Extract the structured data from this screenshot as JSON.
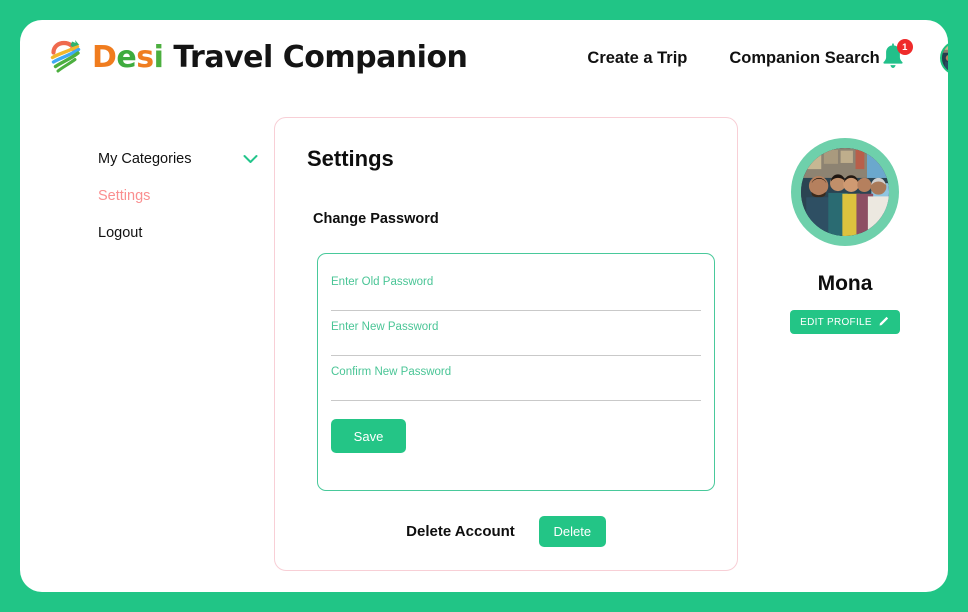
{
  "theme": {
    "page_background": "#21c586",
    "accent_green": "#23c586",
    "field_green": "#4ac596",
    "active_pink": "#fa8f90",
    "card_border_pink": "#f8cfd6",
    "badge_red": "#ef2b2b"
  },
  "header": {
    "brand": {
      "icon": "travel-pin-logo-icon",
      "word_colored": [
        "D",
        "e",
        "s",
        "i"
      ],
      "word_rest": " Travel Companion"
    },
    "nav": [
      {
        "label": "Create a Trip",
        "name": "nav-create-a-trip"
      },
      {
        "label": "Companion Search",
        "name": "nav-companion-search"
      }
    ],
    "notifications": {
      "icon": "bell-icon",
      "count": "1"
    },
    "avatar": {
      "icon": "avatar",
      "alt": "user avatar"
    }
  },
  "sidebar": {
    "items": [
      {
        "label": "My Categories",
        "name": "sidebar-item-my-categories",
        "has_chevron": true,
        "active": false
      },
      {
        "label": "Settings",
        "name": "sidebar-item-settings",
        "has_chevron": false,
        "active": true
      },
      {
        "label": "Logout",
        "name": "sidebar-item-logout",
        "has_chevron": false,
        "active": false
      }
    ]
  },
  "main": {
    "title": "Settings",
    "section_title": "Change Password",
    "fields": [
      {
        "label": "Enter Old Password",
        "value": "",
        "name": "old-password-input"
      },
      {
        "label": "Enter New Password",
        "value": "",
        "name": "new-password-input"
      },
      {
        "label": "Confirm New Password",
        "value": "",
        "name": "confirm-password-input"
      }
    ],
    "save_label": "Save",
    "delete_account_label": "Delete Account",
    "delete_button_label": "Delete"
  },
  "profile": {
    "name": "Mona",
    "edit_label": "EDIT PROFILE",
    "edit_icon": "pencil-icon"
  }
}
